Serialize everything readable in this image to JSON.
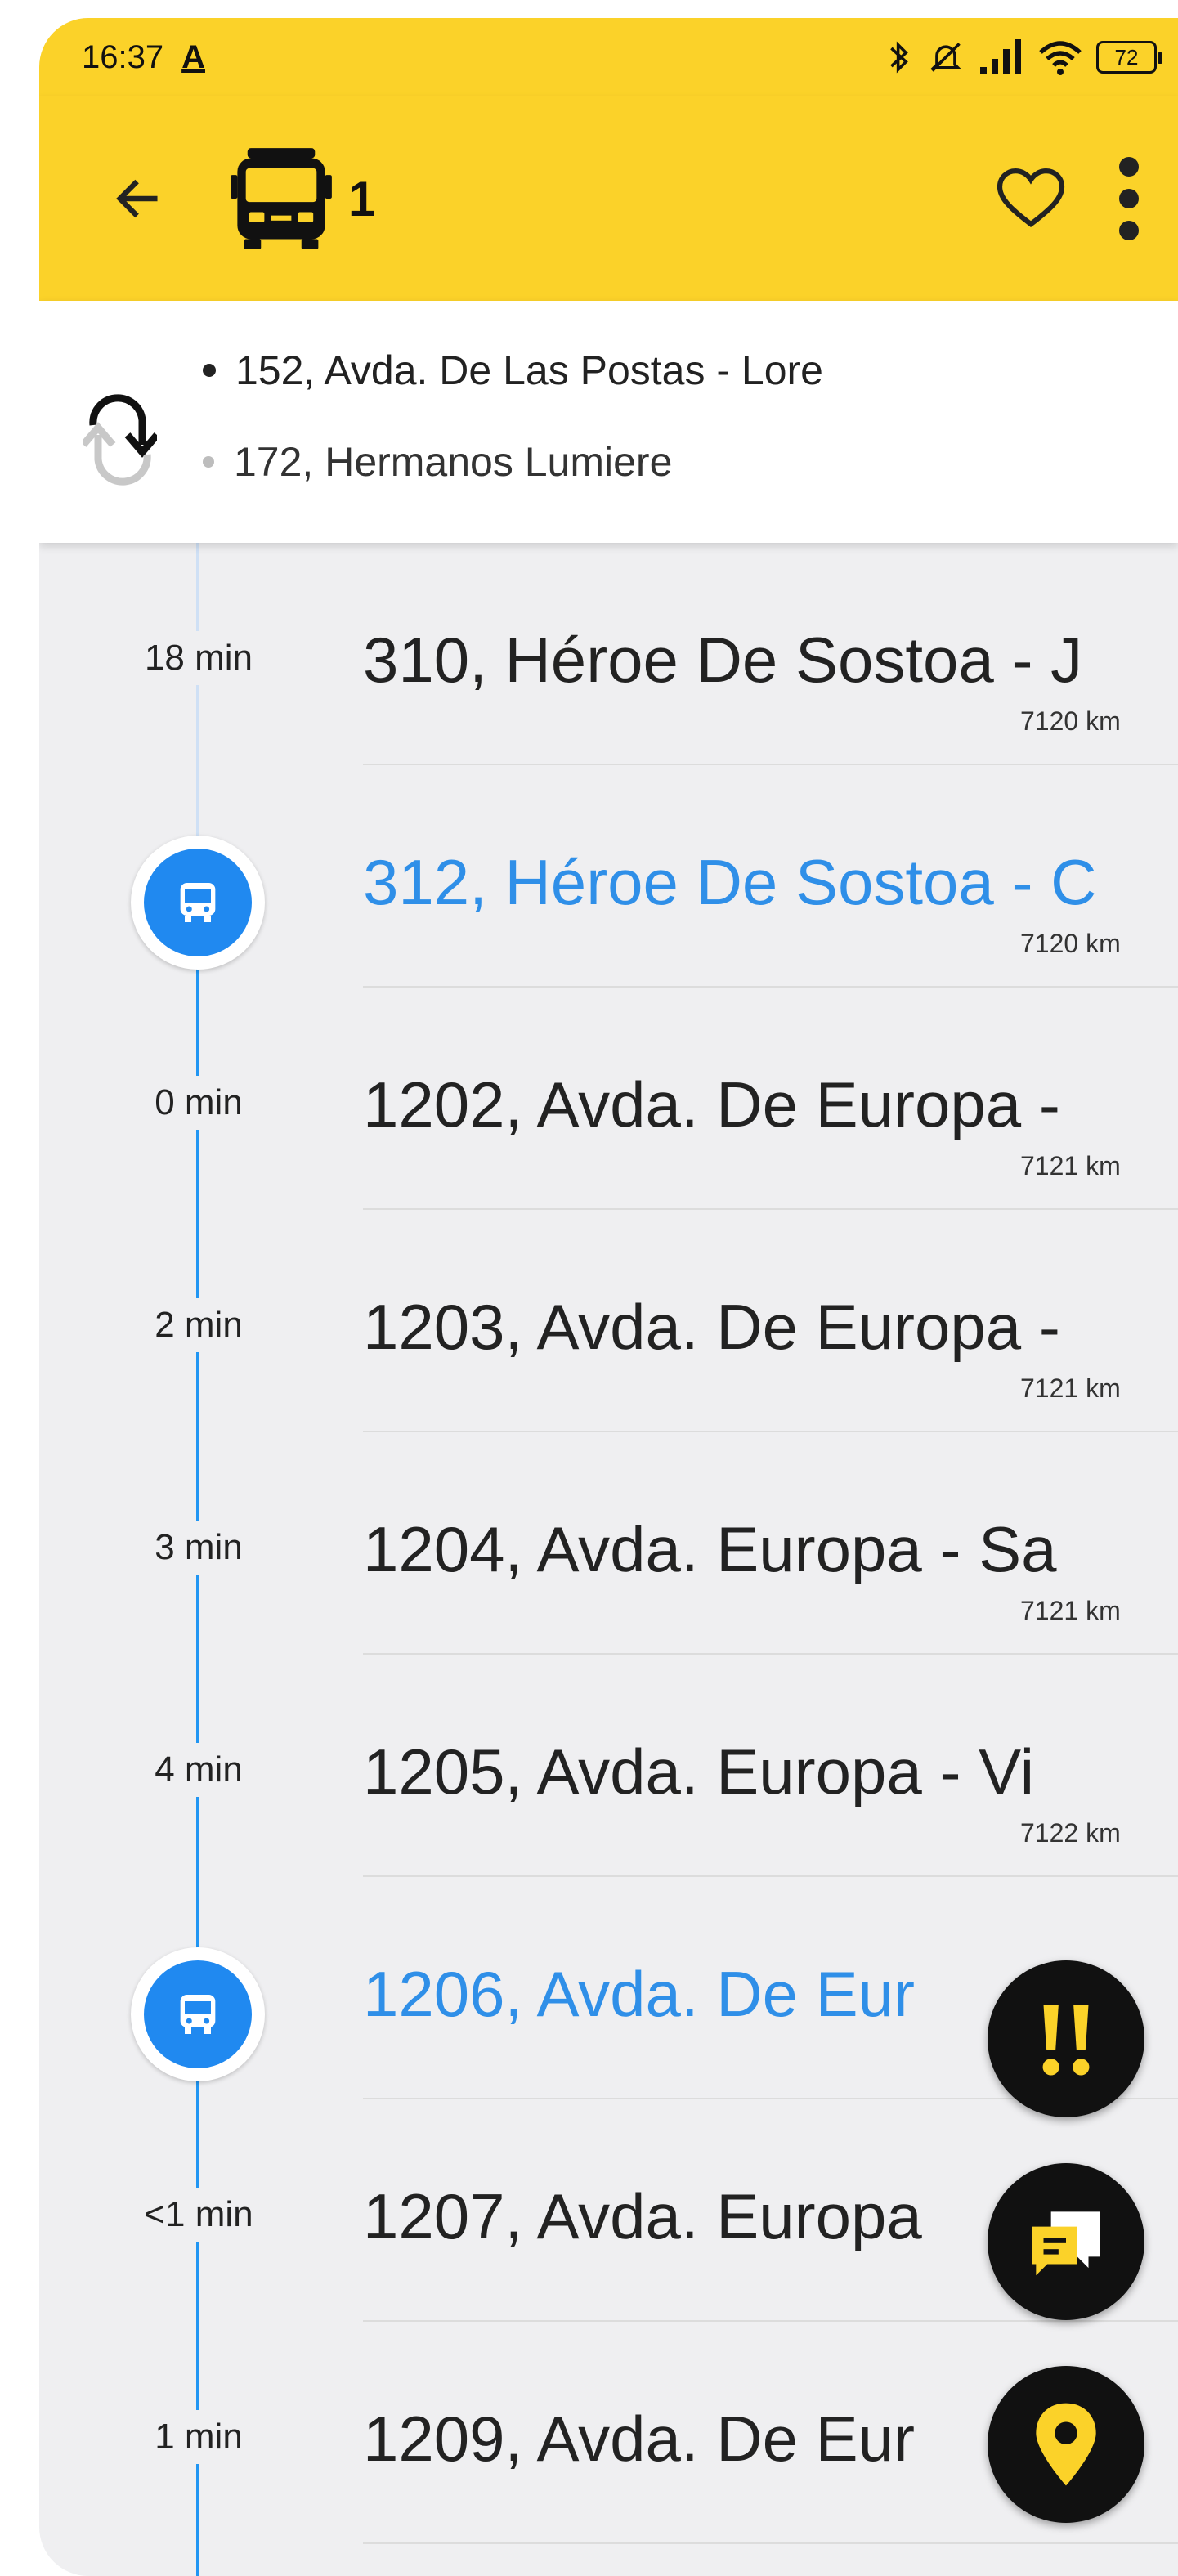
{
  "status_bar": {
    "time": "16:37",
    "notification_letter": "A",
    "battery": "72"
  },
  "toolbar": {
    "line_number": "1",
    "icons": {
      "back": "arrow-left-icon",
      "logo": "bus-icon",
      "favorite": "heart-outline-icon",
      "more": "more-vert-icon"
    }
  },
  "route": {
    "directions": [
      {
        "label": "152, Avda. De Las Postas - Lore"
      },
      {
        "label": "172, Hermanos Lumiere"
      }
    ]
  },
  "stops": [
    {
      "time": "18 min",
      "name": "310, Héroe De Sostoa - J",
      "distance": "7120 km",
      "bus_here": false
    },
    {
      "time": "",
      "name": "312, Héroe De Sostoa - C",
      "distance": "7120 km",
      "bus_here": true
    },
    {
      "time": "0 min",
      "name": "1202, Avda. De Europa -",
      "distance": "7121 km",
      "bus_here": false
    },
    {
      "time": "2 min",
      "name": "1203, Avda. De Europa -",
      "distance": "7121 km",
      "bus_here": false
    },
    {
      "time": "3 min",
      "name": "1204, Avda. Europa - Sa",
      "distance": "7121 km",
      "bus_here": false
    },
    {
      "time": "4 min",
      "name": "1205, Avda. Europa - Vi",
      "distance": "7122 km",
      "bus_here": false
    },
    {
      "time": "",
      "name": "1206, Avda. De Eur",
      "distance": "",
      "bus_here": true
    },
    {
      "time": "<1 min",
      "name": "1207, Avda. Europa",
      "distance": "",
      "bus_here": false
    },
    {
      "time": "1 min",
      "name": "1209, Avda. De Eur",
      "distance": "",
      "bus_here": false
    }
  ],
  "fabs": [
    {
      "icon": "alert-icon",
      "color": "#fbd229"
    },
    {
      "icon": "chat-icon",
      "color": "#fbd229"
    },
    {
      "icon": "location-pin-icon",
      "color": "#fbd229"
    }
  ],
  "colors": {
    "brand_yellow": "#fbd229",
    "active_blue": "#2f8fe8",
    "marker_blue": "#2089f0"
  }
}
